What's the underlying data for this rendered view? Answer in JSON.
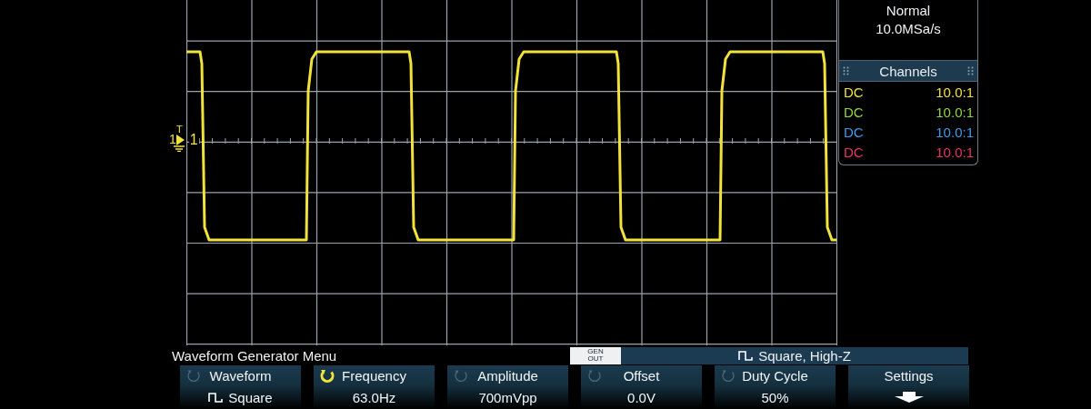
{
  "trace_marker": {
    "channel_label": "1",
    "trigger_label": "T",
    "level_label": "1"
  },
  "acquisition": {
    "mode": "Normal",
    "sample_rate": "10.0MSa/s"
  },
  "channels_panel": {
    "title": "Channels",
    "channels": [
      {
        "coupling": "DC",
        "probe": "10.0:1",
        "color": "#f0e040"
      },
      {
        "coupling": "DC",
        "probe": "10.0:1",
        "color": "#8cd83c"
      },
      {
        "coupling": "DC",
        "probe": "10.0:1",
        "color": "#3c9ce8"
      },
      {
        "coupling": "DC",
        "probe": "10.0:1",
        "color": "#e8306c"
      }
    ]
  },
  "menu": {
    "title": "Waveform Generator Menu",
    "gen_out": {
      "line1": "GEN",
      "line2": "OUT"
    },
    "status": "Square, High-Z"
  },
  "softkeys": [
    {
      "kind": "waveform",
      "label": "Waveform",
      "value": "Square",
      "active": false
    },
    {
      "kind": "knob",
      "label": "Frequency",
      "value": "63.0Hz",
      "active": true
    },
    {
      "kind": "knob",
      "label": "Amplitude",
      "value": "700mVpp",
      "active": false
    },
    {
      "kind": "knob",
      "label": "Offset",
      "value": "0.0V",
      "active": false
    },
    {
      "kind": "knob",
      "label": "Duty Cycle",
      "value": "50%",
      "active": false
    },
    {
      "kind": "submenu",
      "label": "Settings"
    }
  ]
}
